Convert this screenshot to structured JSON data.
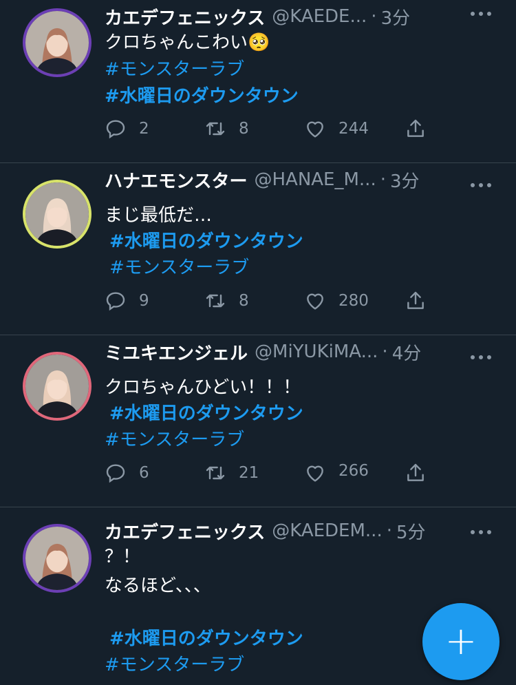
{
  "tweets": [
    {
      "name": "カエデフェニックス",
      "handle": "@KAEDE...",
      "separator": "·",
      "time": "3分",
      "lines": [
        "クロちゃんこわい🥺",
        "#モンスターラブ",
        "#水曜日のダウンタウン"
      ],
      "replies": "2",
      "retweets": "8",
      "likes": "244",
      "avatar_ring": "#6c3fb5"
    },
    {
      "name": "ハナエモンスター",
      "handle": "@HANAE_M...",
      "separator": "·",
      "time": "3分",
      "lines": [
        "まじ最低だ…",
        "#水曜日のダウンタウン",
        "#モンスターラブ"
      ],
      "replies": "9",
      "retweets": "8",
      "likes": "280",
      "avatar_ring": "#d8e36a"
    },
    {
      "name": "ミユキエンジェル",
      "handle": "@MiYUKiMA...",
      "separator": "·",
      "time": "4分",
      "lines": [
        "クロちゃんひどい！！！",
        "#水曜日のダウンタウン",
        "#モンスターラブ"
      ],
      "replies": "6",
      "retweets": "21",
      "likes": "266",
      "avatar_ring": "#e0677a"
    },
    {
      "name": "カエデフェニックス",
      "handle": "@KAEDEM...",
      "separator": "·",
      "time": "5分",
      "lines": [
        "？！",
        "なるほど、、、",
        "#水曜日のダウンタウン",
        "#モンスターラブ"
      ],
      "avatar_ring": "#6c3fb5"
    }
  ],
  "compose_button": {
    "label": "+"
  },
  "icons": [
    "reply-icon",
    "retweet-icon",
    "like-icon",
    "share-icon",
    "more-icon"
  ],
  "colors": {
    "background": "#15202b",
    "link": "#1d9bf0",
    "muted": "#8b98a5",
    "divider": "#38444d"
  }
}
